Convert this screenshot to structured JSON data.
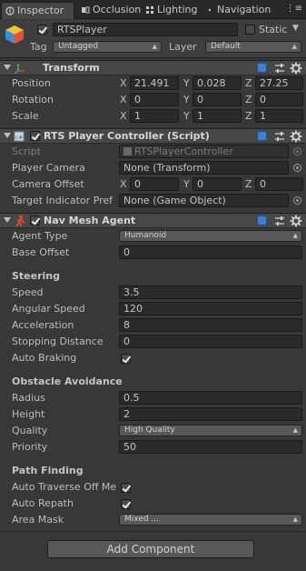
{
  "tabs": [
    {
      "label": "Inspector",
      "active": true
    },
    {
      "label": "Occlusion",
      "active": false
    },
    {
      "label": "Lighting",
      "active": false
    },
    {
      "label": "Navigation",
      "active": false
    }
  ],
  "object": {
    "active": true,
    "name": "RTSPlayer",
    "static_label": "Static",
    "static_checked": false,
    "tag_label": "Tag",
    "tag_value": "Untagged",
    "layer_label": "Layer",
    "layer_value": "Default"
  },
  "transform": {
    "title": "Transform",
    "position": {
      "label": "Position",
      "x": "21.491",
      "y": "0.028",
      "z": "27.25"
    },
    "rotation": {
      "label": "Rotation",
      "x": "0",
      "y": "0",
      "z": "0"
    },
    "scale": {
      "label": "Scale",
      "x": "1",
      "y": "1",
      "z": "1"
    }
  },
  "controller": {
    "title": "RTS Player Controller (Script)",
    "enabled": true,
    "script_label": "Script",
    "script_value": "RTSPlayerController",
    "camera_label": "Player Camera",
    "camera_value": "None (Transform)",
    "offset_label": "Camera Offset",
    "offset_x": "0",
    "offset_y": "0",
    "offset_z": "0",
    "target_label": "Target Indicator Pref",
    "target_value": "None (Game Object)"
  },
  "agent": {
    "title": "Nav Mesh Agent",
    "enabled": true,
    "agent_type_label": "Agent Type",
    "agent_type_value": "Humanoid",
    "base_offset_label": "Base Offset",
    "base_offset_value": "0",
    "steering_title": "Steering",
    "speed_label": "Speed",
    "speed_value": "3.5",
    "angular_label": "Angular Speed",
    "angular_value": "120",
    "accel_label": "Acceleration",
    "accel_value": "8",
    "stopping_label": "Stopping Distance",
    "stopping_value": "0",
    "braking_label": "Auto Braking",
    "braking_checked": true,
    "obstacle_title": "Obstacle Avoidance",
    "radius_label": "Radius",
    "radius_value": "0.5",
    "height_label": "Height",
    "height_value": "2",
    "quality_label": "Quality",
    "quality_value": "High Quality",
    "priority_label": "Priority",
    "priority_value": "50",
    "path_title": "Path Finding",
    "traverse_label": "Auto Traverse Off Me",
    "traverse_checked": true,
    "repath_label": "Auto Repath",
    "repath_checked": true,
    "area_label": "Area Mask",
    "area_value": "Mixed ..."
  },
  "axes": {
    "x": "X",
    "y": "Y",
    "z": "Z"
  },
  "add_component": "Add Component",
  "colors": {
    "background": "#383838",
    "field": "#2a2a2a",
    "help_icon": "#3d7fd0",
    "header": "#474747"
  }
}
